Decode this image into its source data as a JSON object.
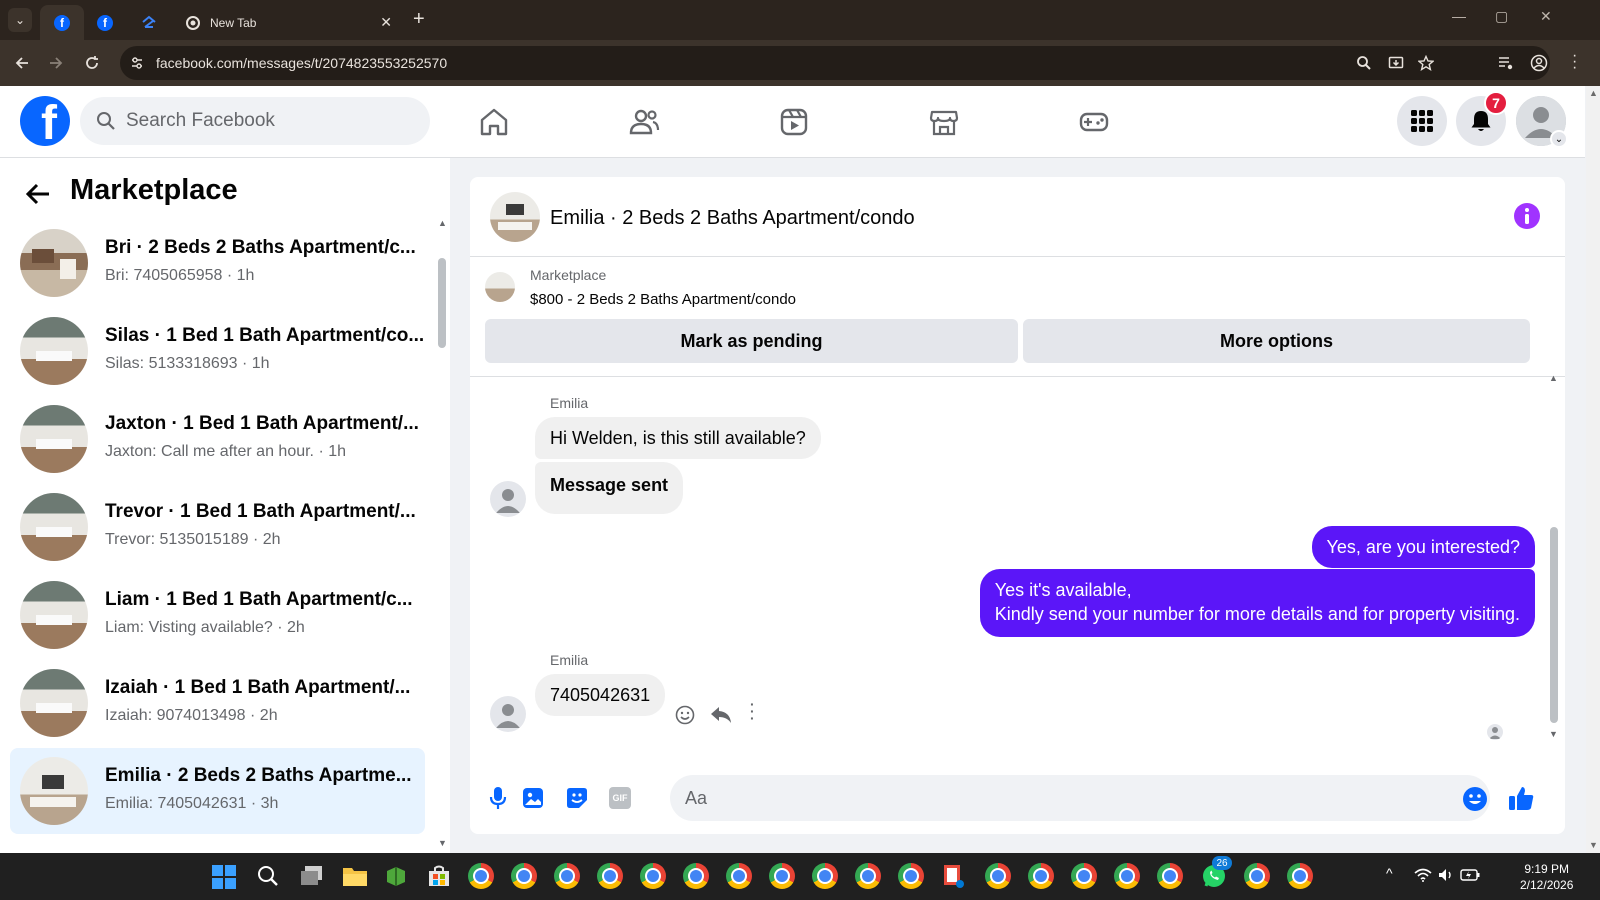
{
  "browser": {
    "tabs": [
      {
        "label": "",
        "icon": "facebook-icon"
      },
      {
        "label": "",
        "icon": "facebook-icon"
      },
      {
        "label": "",
        "icon": "zillow-icon"
      },
      {
        "label": "New Tab",
        "icon": "chrome-icon"
      }
    ],
    "url": "facebook.com/messages/t/2074823553252570"
  },
  "header": {
    "search_placeholder": "Search Facebook",
    "notification_count": "7"
  },
  "sidebar": {
    "title": "Marketplace",
    "conversations": [
      {
        "title": "Bri · 2 Beds 2 Baths Apartment/c...",
        "subtitle": "Bri: 7405065958 · 1h"
      },
      {
        "title": "Silas · 1 Bed 1 Bath Apartment/co...",
        "subtitle": "Silas: 5133318693 · 1h"
      },
      {
        "title": "Jaxton · 1 Bed 1 Bath Apartment/...",
        "subtitle": "Jaxton: Call me after an hour. · 1h"
      },
      {
        "title": "Trevor · 1 Bed 1 Bath Apartment/...",
        "subtitle": "Trevor: 5135015189 · 2h"
      },
      {
        "title": "Liam · 1 Bed 1 Bath Apartment/c...",
        "subtitle": "Liam: Visting available? · 2h"
      },
      {
        "title": "Izaiah · 1 Bed 1 Bath Apartment/...",
        "subtitle": "Izaiah: 9074013498 · 2h"
      },
      {
        "title": "Emilia · 2 Beds 2 Baths Apartme...",
        "subtitle": "Emilia: 7405042631 · 3h"
      }
    ]
  },
  "chat": {
    "title": "Emilia · 2 Beds 2 Baths Apartment/condo",
    "listing": {
      "label": "Marketplace",
      "name": "$800 - 2 Beds 2 Baths Apartment/condo",
      "mark_pending": "Mark as pending",
      "more_options": "More options"
    },
    "messages": [
      {
        "sender": "Emilia",
        "text": "Hi Welden, is this still available?"
      },
      {
        "text": "Message sent"
      },
      {
        "text": "Yes, are you interested?"
      },
      {
        "text": "Yes it's available,"
      },
      {
        "text": "Kindly send your number for more details and for property visiting."
      },
      {
        "sender": "Emilia",
        "text": "7405042631"
      }
    ],
    "composer_placeholder": "Aa"
  },
  "taskbar": {
    "time": "9:19 PM",
    "date": "2/12/2026",
    "whatsapp_badge": "26"
  },
  "colors": {
    "fb_blue": "#0866ff",
    "outgoing_bubble": "#5b16f8",
    "info_purple": "#a033ff",
    "selected_conversation": "#e7f3ff",
    "badge_red": "#e41e3f"
  }
}
